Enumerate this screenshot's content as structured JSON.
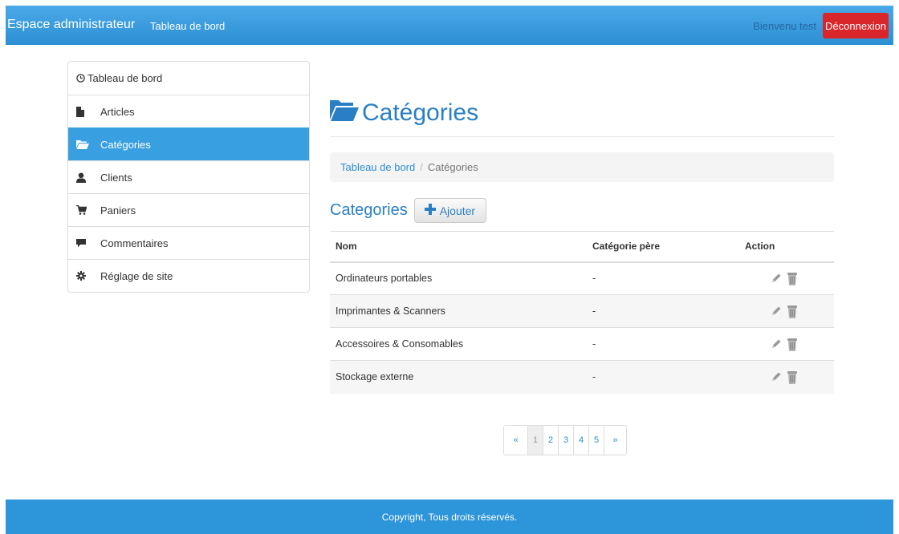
{
  "navbar": {
    "brand": "Espace administrateur",
    "link": "Tableau de bord",
    "welcome": "Bienvenu test",
    "logout_label": "Déconnexion"
  },
  "sidebar": {
    "items": [
      {
        "label": "Tableau de bord",
        "icon": "clock-icon"
      },
      {
        "label": "Articles",
        "icon": "file-icon"
      },
      {
        "label": "Catégories",
        "icon": "folder-open-icon",
        "active": true
      },
      {
        "label": "Clients",
        "icon": "user-icon"
      },
      {
        "label": "Paniers",
        "icon": "cart-icon"
      },
      {
        "label": "Commentaires",
        "icon": "comment-icon"
      },
      {
        "label": "Réglage de site",
        "icon": "cog-icon"
      }
    ]
  },
  "page": {
    "title": "Catégories",
    "breadcrumb": {
      "home": "Tableau de bord",
      "current": "Catégories",
      "separator": "/"
    },
    "section_title": "Categories",
    "add_label": "Ajouter"
  },
  "table": {
    "headers": [
      "Nom",
      "Catégorie père",
      "Action"
    ],
    "rows": [
      {
        "nom": "Ordinateurs portables",
        "pere": "-"
      },
      {
        "nom": "Imprimantes & Scanners",
        "pere": "-"
      },
      {
        "nom": "Accessoires & Consomables",
        "pere": "-"
      },
      {
        "nom": "Stockage externe",
        "pere": "-"
      }
    ]
  },
  "pagination": {
    "prev": "«",
    "pages": [
      "1",
      "2",
      "3",
      "4",
      "5"
    ],
    "current": "1",
    "next": "»"
  },
  "footer": {
    "text": "Copyright, Tous droits réservés."
  },
  "colors": {
    "primary": "#2d8fd3",
    "danger": "#d9262b",
    "active_item": "#38a0e0"
  }
}
